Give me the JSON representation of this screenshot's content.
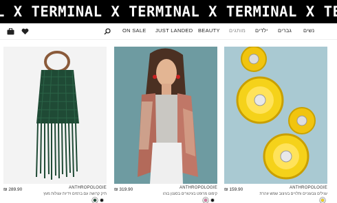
{
  "banner": {
    "text": "L X TERMINAL X TERMINAL X TERMINAL X TERMINAL X TERMINAL X TERMINAL X TERMINAL"
  },
  "nav": {
    "icons": [
      "bag-icon",
      "heart-icon",
      "search-icon"
    ],
    "items": [
      {
        "label": "ON SALE",
        "muted": false
      },
      {
        "label": "JUST LANDED",
        "muted": false
      },
      {
        "label": "BEAUTY",
        "muted": false
      },
      {
        "label": "מותגים",
        "muted": true
      },
      {
        "label": "ילדים",
        "muted": false
      },
      {
        "label": "גברים",
        "muted": false
      },
      {
        "label": "נשים",
        "muted": false
      }
    ]
  },
  "products": [
    {
      "brand": "ANTHROPOLOGIE",
      "description": "תיק קרושה עם ברמים וידיות עגולות מעץ",
      "price": "289.90",
      "currency": "₪",
      "swatches": [
        "#1f4a35",
        "#111111"
      ]
    },
    {
      "brand": "ANTHROPOLOGIE",
      "description": "קימונו מרופט בעיטורים בסגנון בוהו",
      "price": "319.90",
      "currency": "₪",
      "swatches": [
        "#d67aa2",
        "#111111"
      ]
    },
    {
      "brand": "ANTHROPOLOGIE",
      "description": "עגילים צבעוניים ותלויים בעיצוב שמש זוהרת",
      "price": "159.90",
      "currency": "₪",
      "swatches": [
        "#f3d21a"
      ]
    }
  ]
}
